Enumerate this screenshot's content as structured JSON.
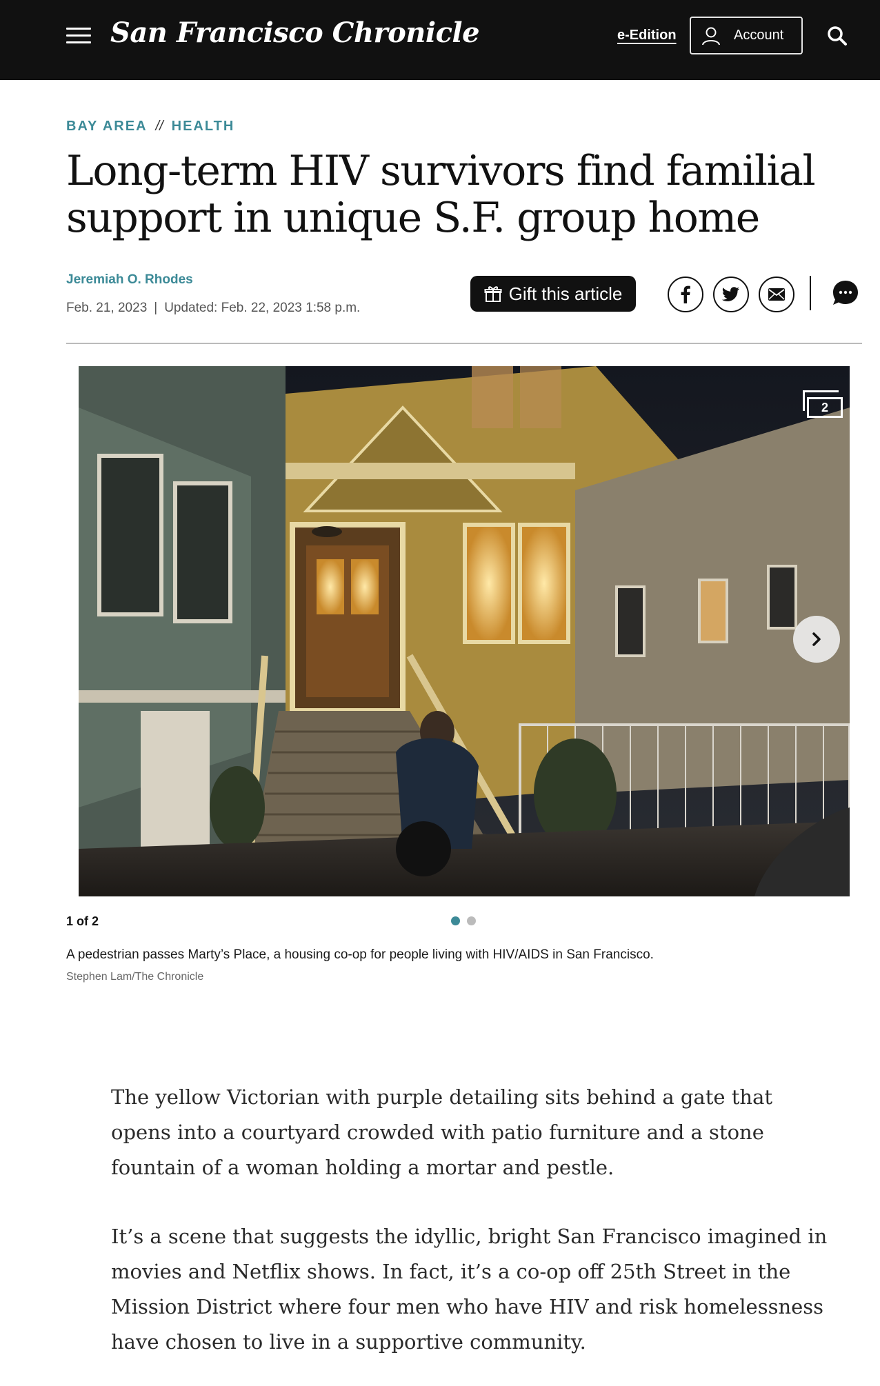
{
  "header": {
    "logo": "San Francisco Chronicle",
    "e_edition": "e-Edition",
    "account_label": "Account"
  },
  "sections": {
    "primary": "BAY AREA",
    "separator": "//",
    "secondary": "HEALTH"
  },
  "article": {
    "headline": "Long-term HIV survivors find familial support in unique S.F. group home",
    "author": "Jeremiah O. Rhodes",
    "published": "Feb. 21, 2023",
    "date_separator": "|",
    "updated": "Updated: Feb. 22, 2023 1:58 p.m.",
    "gift_label": "Gift this article",
    "paragraphs": [
      "The yellow Victorian with purple detailing sits behind a gate that opens into a courtyard crowded with patio furniture and a stone fountain of a woman holding a mortar and pestle.",
      "It’s a scene that suggests the idyllic, bright San Francisco imagined in movies and Netflix shows. In fact, it’s a co-op off 25th Street in the Mission District where four men who have HIV and risk homelessness have chosen to live in a supportive community."
    ]
  },
  "gallery": {
    "photo_count": "2",
    "position": "1 of 2",
    "caption": "A pedestrian passes Marty’s Place, a housing co-op for people living with HIV/AIDS in San Francisco.",
    "credit": "Stephen Lam/The Chronicle",
    "current_index": 1,
    "total": 2
  },
  "colors": {
    "accent": "#3c8a97",
    "header_bg": "#111111",
    "house_yellow": "#c9a64a"
  },
  "icons": [
    "hamburger-menu-icon",
    "user-icon",
    "search-icon",
    "gift-icon",
    "facebook-icon",
    "twitter-icon",
    "email-icon",
    "comment-icon",
    "chevron-right-icon",
    "gallery-stack-icon"
  ]
}
